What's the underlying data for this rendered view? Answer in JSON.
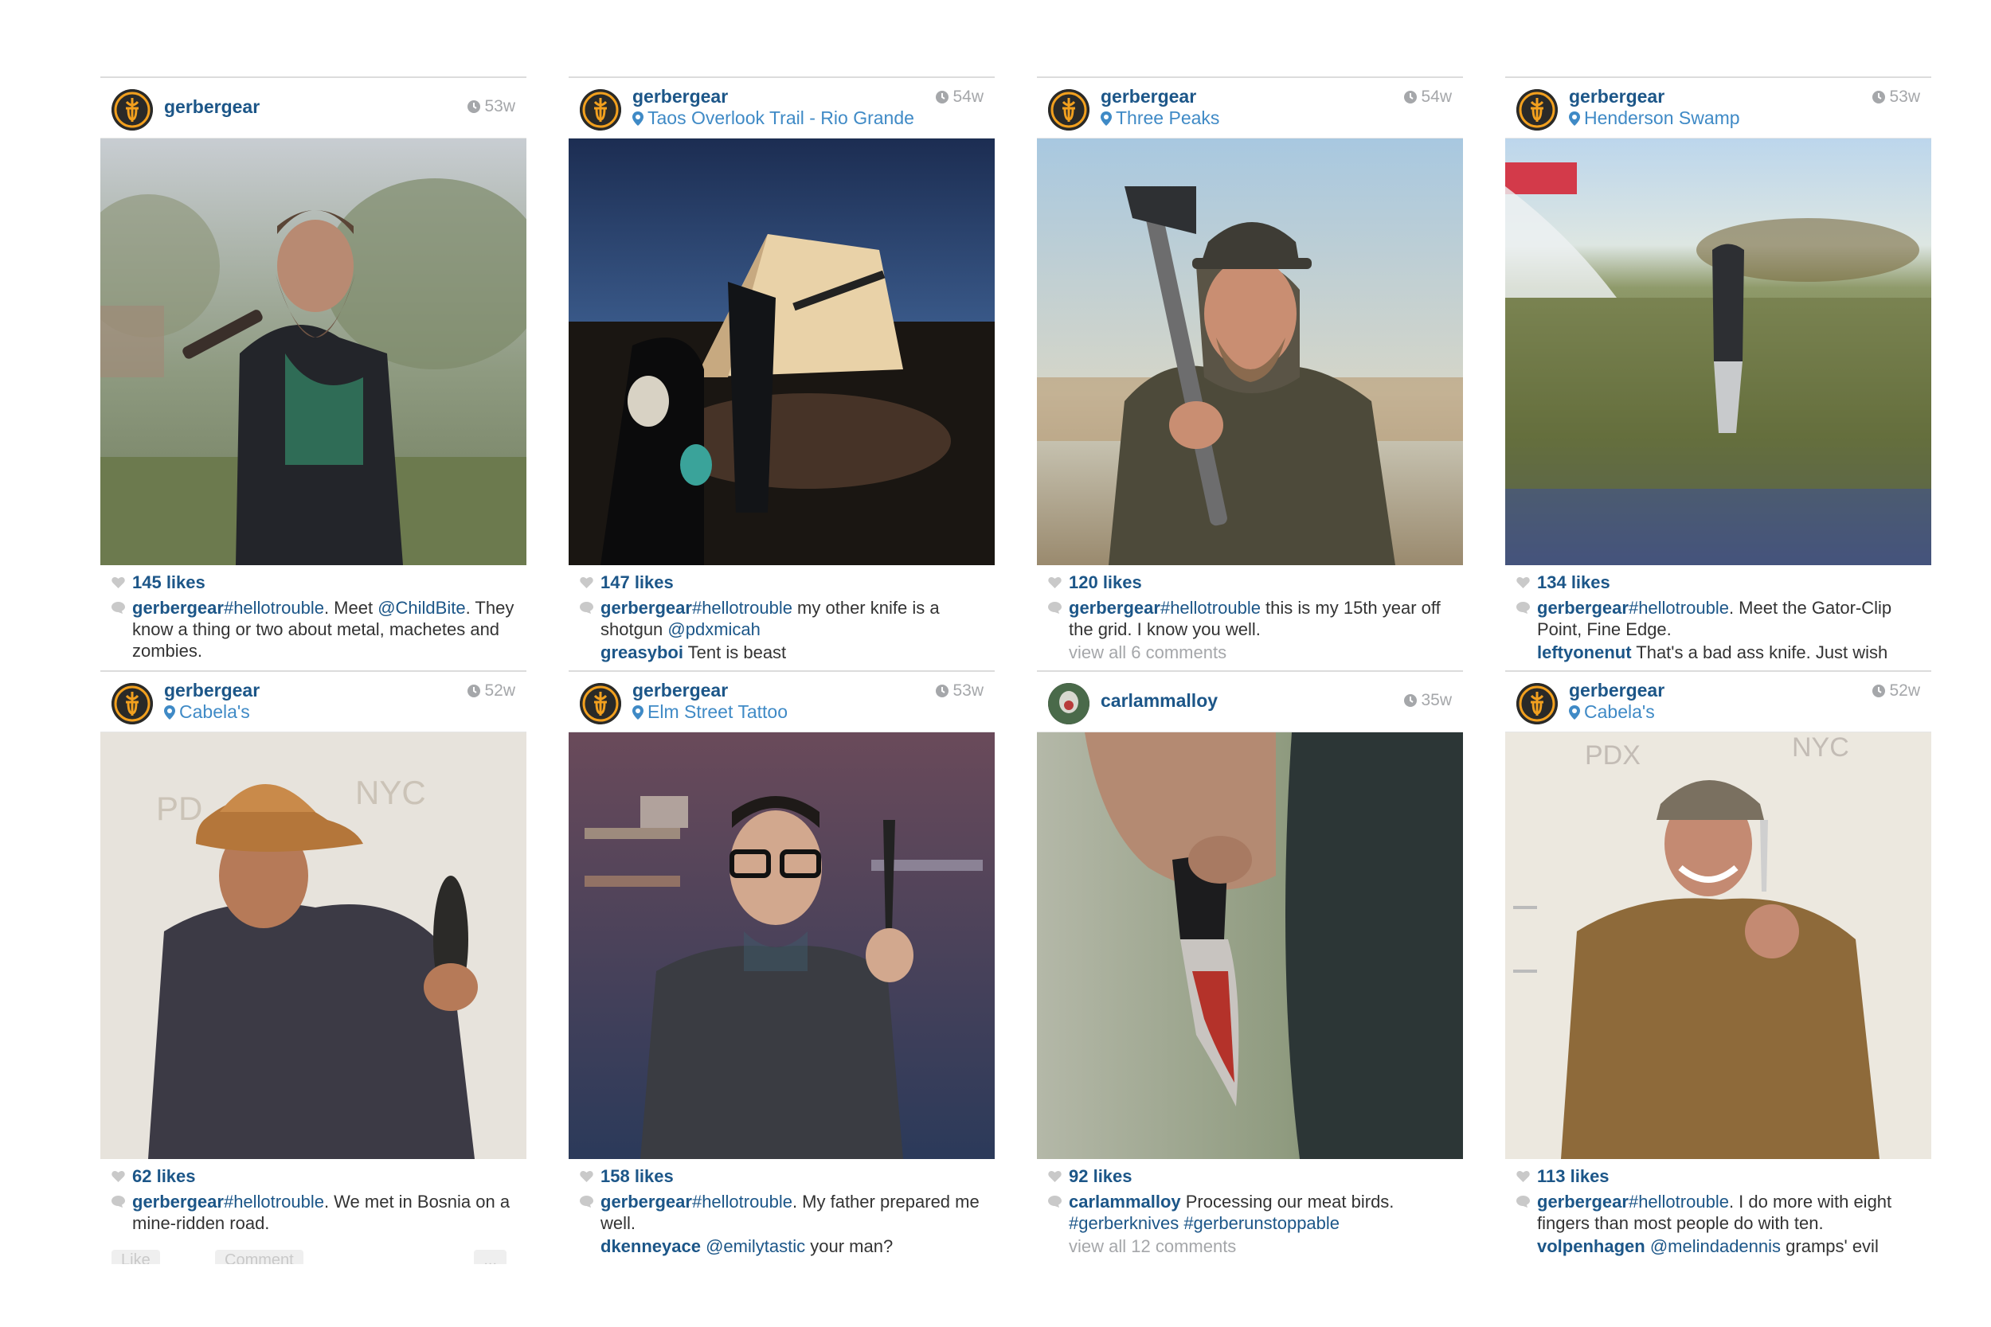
{
  "feed": {
    "posts": [
      {
        "username": "gerbergear",
        "location": "",
        "time": "53w",
        "likes": "145 likes",
        "caption_user": "gerbergear",
        "caption_parts": [
          [
            "#hellotrouble",
            "tag"
          ],
          [
            ". Meet ",
            "txt"
          ],
          [
            "@ChildBite",
            "tag"
          ],
          [
            ". They know a thing or two about metal, machetes and zombies.",
            "txt"
          ]
        ],
        "comment": null,
        "view_all": ""
      },
      {
        "username": "gerbergear",
        "location": "Taos Overlook Trail - Rio Grande",
        "time": "54w",
        "likes": "147 likes",
        "caption_user": "gerbergear",
        "caption_parts": [
          [
            "#hellotrouble",
            "tag"
          ],
          [
            " my other knife is a shotgun ",
            "txt"
          ],
          [
            "@pdxmicah",
            "tag"
          ]
        ],
        "comment": {
          "user": "greasyboi",
          "text": " Tent is beast"
        },
        "view_all": ""
      },
      {
        "username": "gerbergear",
        "location": "Three Peaks",
        "time": "54w",
        "likes": "120 likes",
        "caption_user": "gerbergear",
        "caption_parts": [
          [
            "#hellotrouble",
            "tag"
          ],
          [
            " this is my 15th year off the grid. I  know you well.",
            "txt"
          ]
        ],
        "comment": null,
        "view_all": "view all 6 comments"
      },
      {
        "username": "gerbergear",
        "location": "Henderson Swamp",
        "time": "53w",
        "likes": "134 likes",
        "caption_user": "gerbergear",
        "caption_parts": [
          [
            "#hellotrouble",
            "tag"
          ],
          [
            ". Meet the Gator-Clip Point, Fine Edge.",
            "txt"
          ]
        ],
        "comment": {
          "user": "leftyonenut",
          "text": " That's a bad ass knife. Just wish"
        },
        "view_all": ""
      },
      {
        "username": "gerbergear",
        "location": "Cabela's",
        "time": "52w",
        "likes": "62 likes",
        "caption_user": "gerbergear",
        "caption_parts": [
          [
            "#hellotrouble",
            "tag"
          ],
          [
            ". We met in Bosnia on a mine-ridden road.",
            "txt"
          ]
        ],
        "comment": null,
        "view_all": "",
        "action_like": "Like",
        "action_comment": "Comment",
        "action_more": "..."
      },
      {
        "username": "gerbergear",
        "location": "Elm Street Tattoo",
        "time": "53w",
        "likes": "158 likes",
        "caption_user": "gerbergear",
        "caption_parts": [
          [
            "#hellotrouble",
            "tag"
          ],
          [
            ". My father prepared me well.",
            "txt"
          ]
        ],
        "comment": {
          "user": "dkenneyace",
          "mention": "@emilytastic",
          "text": " your man?"
        },
        "view_all": ""
      },
      {
        "username": "carlammalloy",
        "location": "",
        "time": "35w",
        "likes": "92 likes",
        "caption_user": "carlammalloy",
        "caption_parts": [
          [
            " Processing our meat birds. ",
            "txt"
          ],
          [
            "#gerberknives",
            "tag"
          ],
          [
            " ",
            "txt"
          ],
          [
            "#gerberunstoppable",
            "tag"
          ]
        ],
        "comment": null,
        "view_all": "view all 12 comments"
      },
      {
        "username": "gerbergear",
        "location": "Cabela's",
        "time": "52w",
        "likes": "113 likes",
        "caption_user": "gerbergear",
        "caption_parts": [
          [
            "#hellotrouble",
            "tag"
          ],
          [
            ". I do more with eight fingers than most people do with ten.",
            "txt"
          ]
        ],
        "comment": {
          "user": "volpenhagen",
          "mention": "@melindadennis",
          "text": " gramps' evil"
        },
        "view_all": ""
      }
    ]
  },
  "colors": {
    "link": "#1c5688",
    "location": "#3f8ac6",
    "muted": "#a5a7aa",
    "brand_orange": "#f2a01e"
  },
  "icons": [
    "gerber-logo-icon",
    "location-pin-icon",
    "clock-icon",
    "heart-icon",
    "comment-bubble-icon"
  ]
}
